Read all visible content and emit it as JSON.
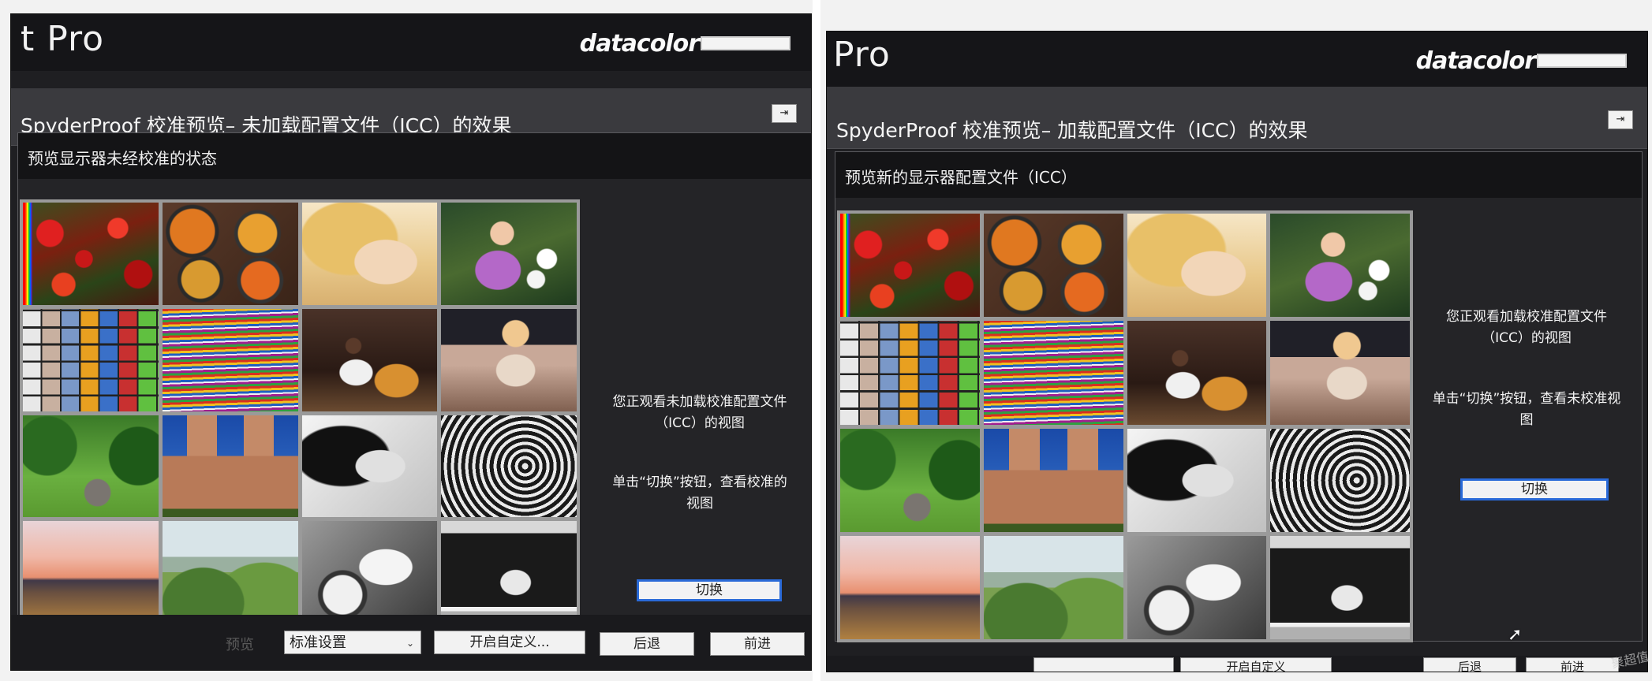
{
  "left_shot": {
    "app_title": "t Pro",
    "brand": "datacolor",
    "heading": "SpyderProof 校准预览– 未加载配置文件（ICC）的效果",
    "pin_label": "⇥",
    "subheading": "预览显示器未经校准的状态",
    "message_1": "您正观看未加载校准配置文件（ICC）的视图",
    "message_2": "单击“切换”按钮，查看校准的视图",
    "toggle_label": "切换",
    "footer": {
      "label": "预览",
      "select_value": "标准设置",
      "custom_label": "开启自定义...",
      "back_label": "后退",
      "next_label": "前进"
    }
  },
  "right_shot": {
    "app_title": "Pro",
    "brand": "datacolor",
    "heading": "SpyderProof 校准预览– 加载配置文件（ICC）的效果",
    "pin_label": "⇥",
    "subheading": "预览新的显示器配置文件（ICC）",
    "message_1": "您正观看加载校准配置文件（ICC）的视图",
    "message_2": "单击“切换”按钮，查看未校准视图",
    "toggle_label": "切换",
    "footer": {
      "custom_label": "开启自定义",
      "back_label": "后退",
      "next_label": "前进"
    }
  },
  "watermark": "聚超值",
  "icons": {
    "cursor": "mouse-pointer-icon",
    "pin": "pin-panel-icon",
    "select": "chevron-down-icon"
  },
  "colors": {
    "window_bg": "#1f1f22",
    "header_bg": "#3a3a3e",
    "toggle_border": "#2a6ad8"
  }
}
